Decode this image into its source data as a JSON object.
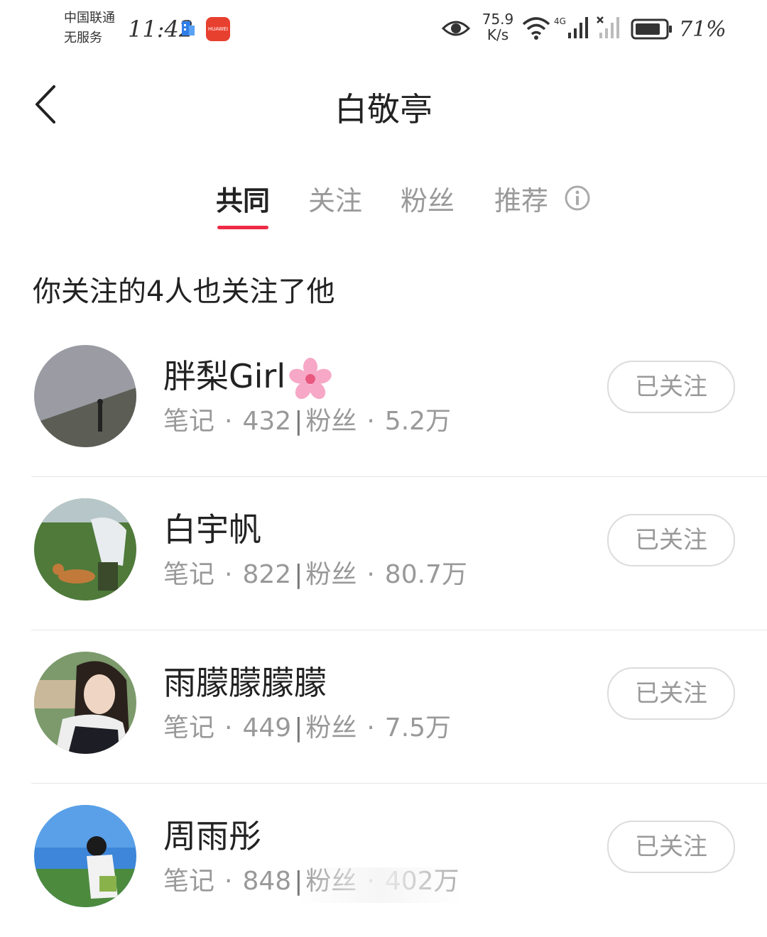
{
  "status_bar": {
    "carrier_line1": "中国联通",
    "carrier_line2": "无服务",
    "time": "11:42",
    "net_speed_value": "75.9",
    "net_speed_unit": "K/s",
    "network_type": "4G",
    "battery": "71%"
  },
  "header": {
    "title": "白敬亭"
  },
  "tabs": [
    {
      "label": "共同",
      "active": true
    },
    {
      "label": "关注",
      "active": false
    },
    {
      "label": "粉丝",
      "active": false
    },
    {
      "label": "推荐",
      "active": false
    }
  ],
  "subtitle": "你关注的4人也关注了他",
  "users": [
    {
      "name": "胖梨Girl",
      "notes_label": "笔记",
      "notes": "432",
      "fans_label": "粉丝",
      "fans": "5.2万",
      "button": "已关注"
    },
    {
      "name": "白宇帆",
      "notes_label": "笔记",
      "notes": "822",
      "fans_label": "粉丝",
      "fans": "80.7万",
      "button": "已关注"
    },
    {
      "name": "雨朦朦朦朦",
      "notes_label": "笔记",
      "notes": "449",
      "fans_label": "粉丝",
      "fans": "7.5万",
      "button": "已关注"
    },
    {
      "name": "周雨彤",
      "notes_label": "笔记",
      "notes": "848",
      "fans_label": "粉丝",
      "fans": "402万",
      "button": "已关注"
    }
  ],
  "colors": {
    "accent": "#ee2a45",
    "text_primary": "#222222",
    "text_secondary": "#999999"
  }
}
